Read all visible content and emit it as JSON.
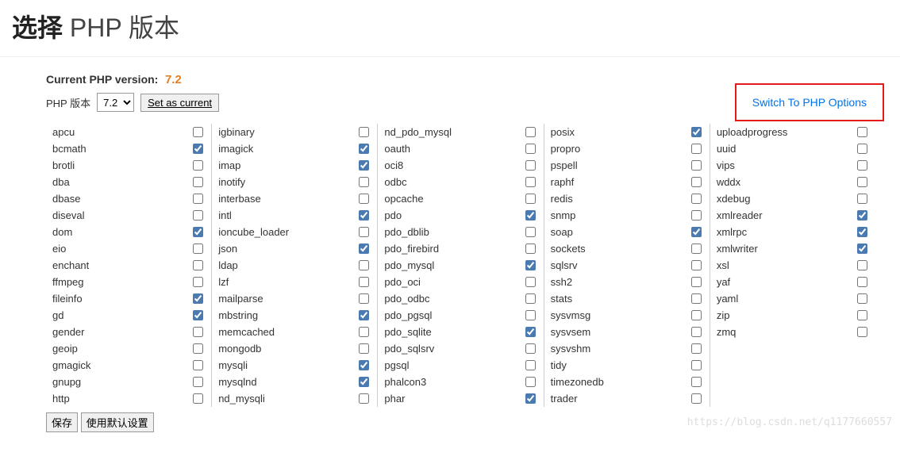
{
  "title_bold": "选择",
  "title_rest": " PHP 版本",
  "current_version_label": "Current PHP version:",
  "current_version_value": "7.2",
  "selector_label": "PHP 版本",
  "selector_value": "7.2",
  "set_current_label": "Set as current",
  "switch_link_label": "Switch To PHP Options",
  "save_button_label": "保存",
  "default_button_label": "使用默认设置",
  "watermark": "https://blog.csdn.net/q1177660557",
  "columns": [
    [
      {
        "name": "apcu",
        "checked": false
      },
      {
        "name": "bcmath",
        "checked": true
      },
      {
        "name": "brotli",
        "checked": false
      },
      {
        "name": "dba",
        "checked": false
      },
      {
        "name": "dbase",
        "checked": false
      },
      {
        "name": "diseval",
        "checked": false
      },
      {
        "name": "dom",
        "checked": true
      },
      {
        "name": "eio",
        "checked": false
      },
      {
        "name": "enchant",
        "checked": false
      },
      {
        "name": "ffmpeg",
        "checked": false
      },
      {
        "name": "fileinfo",
        "checked": true
      },
      {
        "name": "gd",
        "checked": true
      },
      {
        "name": "gender",
        "checked": false
      },
      {
        "name": "geoip",
        "checked": false
      },
      {
        "name": "gmagick",
        "checked": false
      },
      {
        "name": "gnupg",
        "checked": false
      },
      {
        "name": "http",
        "checked": false
      }
    ],
    [
      {
        "name": "igbinary",
        "checked": false
      },
      {
        "name": "imagick",
        "checked": true
      },
      {
        "name": "imap",
        "checked": true
      },
      {
        "name": "inotify",
        "checked": false
      },
      {
        "name": "interbase",
        "checked": false
      },
      {
        "name": "intl",
        "checked": true
      },
      {
        "name": "ioncube_loader",
        "checked": false
      },
      {
        "name": "json",
        "checked": true
      },
      {
        "name": "ldap",
        "checked": false
      },
      {
        "name": "lzf",
        "checked": false
      },
      {
        "name": "mailparse",
        "checked": false
      },
      {
        "name": "mbstring",
        "checked": true
      },
      {
        "name": "memcached",
        "checked": false
      },
      {
        "name": "mongodb",
        "checked": false
      },
      {
        "name": "mysqli",
        "checked": true
      },
      {
        "name": "mysqlnd",
        "checked": true
      },
      {
        "name": "nd_mysqli",
        "checked": false
      }
    ],
    [
      {
        "name": "nd_pdo_mysql",
        "checked": false
      },
      {
        "name": "oauth",
        "checked": false
      },
      {
        "name": "oci8",
        "checked": false
      },
      {
        "name": "odbc",
        "checked": false
      },
      {
        "name": "opcache",
        "checked": false
      },
      {
        "name": "pdo",
        "checked": true
      },
      {
        "name": "pdo_dblib",
        "checked": false
      },
      {
        "name": "pdo_firebird",
        "checked": false
      },
      {
        "name": "pdo_mysql",
        "checked": true
      },
      {
        "name": "pdo_oci",
        "checked": false
      },
      {
        "name": "pdo_odbc",
        "checked": false
      },
      {
        "name": "pdo_pgsql",
        "checked": false
      },
      {
        "name": "pdo_sqlite",
        "checked": true
      },
      {
        "name": "pdo_sqlsrv",
        "checked": false
      },
      {
        "name": "pgsql",
        "checked": false
      },
      {
        "name": "phalcon3",
        "checked": false
      },
      {
        "name": "phar",
        "checked": true
      }
    ],
    [
      {
        "name": "posix",
        "checked": true
      },
      {
        "name": "propro",
        "checked": false
      },
      {
        "name": "pspell",
        "checked": false
      },
      {
        "name": "raphf",
        "checked": false
      },
      {
        "name": "redis",
        "checked": false
      },
      {
        "name": "snmp",
        "checked": false
      },
      {
        "name": "soap",
        "checked": true
      },
      {
        "name": "sockets",
        "checked": false
      },
      {
        "name": "sqlsrv",
        "checked": false
      },
      {
        "name": "ssh2",
        "checked": false
      },
      {
        "name": "stats",
        "checked": false
      },
      {
        "name": "sysvmsg",
        "checked": false
      },
      {
        "name": "sysvsem",
        "checked": false
      },
      {
        "name": "sysvshm",
        "checked": false
      },
      {
        "name": "tidy",
        "checked": false
      },
      {
        "name": "timezonedb",
        "checked": false
      },
      {
        "name": "trader",
        "checked": false
      }
    ],
    [
      {
        "name": "uploadprogress",
        "checked": false
      },
      {
        "name": "uuid",
        "checked": false
      },
      {
        "name": "vips",
        "checked": false
      },
      {
        "name": "wddx",
        "checked": false
      },
      {
        "name": "xdebug",
        "checked": false
      },
      {
        "name": "xmlreader",
        "checked": true
      },
      {
        "name": "xmlrpc",
        "checked": true
      },
      {
        "name": "xmlwriter",
        "checked": true
      },
      {
        "name": "xsl",
        "checked": false
      },
      {
        "name": "yaf",
        "checked": false
      },
      {
        "name": "yaml",
        "checked": false
      },
      {
        "name": "zip",
        "checked": false
      },
      {
        "name": "zmq",
        "checked": false
      }
    ]
  ]
}
